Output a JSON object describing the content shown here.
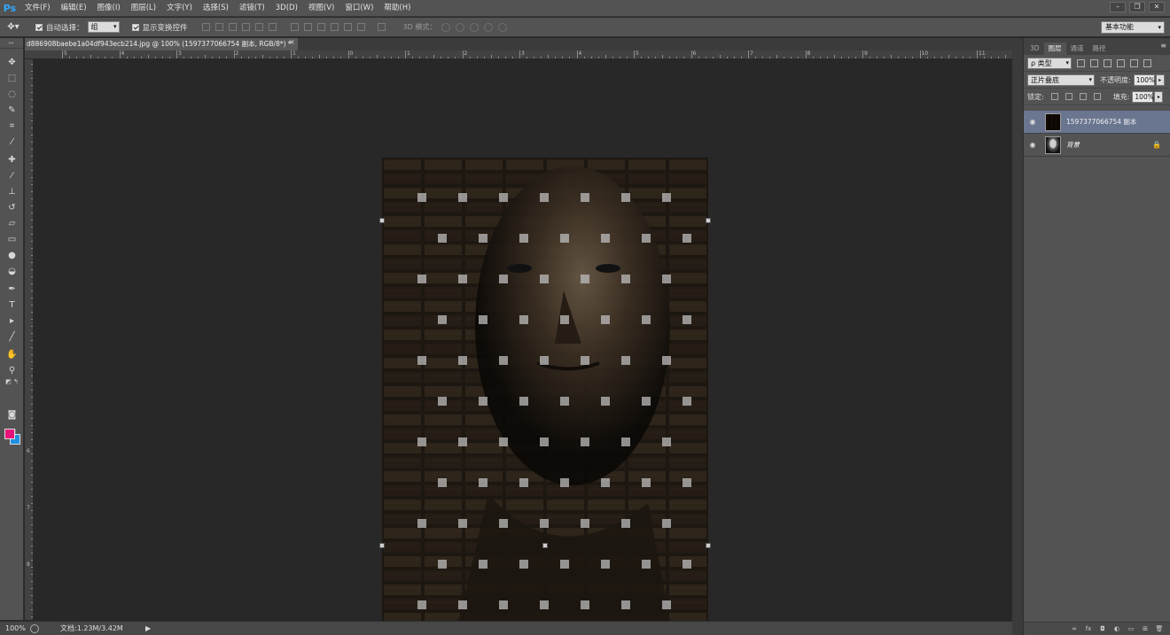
{
  "app": {
    "logo": "Ps",
    "menus": [
      "文件(F)",
      "编辑(E)",
      "图像(I)",
      "图层(L)",
      "文字(Y)",
      "选择(S)",
      "滤镜(T)",
      "3D(D)",
      "视图(V)",
      "窗口(W)",
      "帮助(H)"
    ],
    "window_controls": [
      "–",
      "❐",
      "✕"
    ]
  },
  "options": {
    "auto_select_label": "自动选择：",
    "auto_select_value": "组",
    "show_transform_label": "显示变换控件",
    "mode_3d_label": "3D 模式：",
    "workspace": "基本功能"
  },
  "document": {
    "tab_title": "d886908baebe1a04df943ecb214.jpg @ 100% (1597377066754 副本, RGB/8*) *",
    "tab_close": "×"
  },
  "rulers": {
    "top_labels": [
      "5",
      "4",
      "3",
      "2",
      "1",
      "0",
      "1",
      "2",
      "3",
      "4",
      "5",
      "6",
      "7",
      "8",
      "9",
      "10",
      "11"
    ],
    "left_labels": [
      "6",
      "7",
      "8"
    ]
  },
  "status": {
    "zoom": "100%",
    "doc_size": "文档:1.23M/3.42M",
    "arrow": "▶"
  },
  "panel": {
    "tabs": [
      "3D",
      "图层",
      "通道",
      "路径"
    ],
    "active_tab": "图层",
    "menu_icon": "≡",
    "filter_kind": "ρ 类型",
    "blend_mode": "正片叠底",
    "opacity_label": "不透明度:",
    "opacity_value": "100%",
    "lock_label": "锁定:",
    "fill_label": "填充:",
    "fill_value": "100%",
    "layers": [
      {
        "name": "1597377066754 副本",
        "selected": true
      },
      {
        "name": "背景",
        "selected": false,
        "locked": true
      }
    ],
    "footer_icons": [
      "link-icon",
      "fx-icon",
      "mask-icon",
      "adjustment-icon",
      "group-icon",
      "new-layer-icon",
      "trash-icon"
    ],
    "footer_glyphs": [
      "∞",
      "fx",
      "◘",
      "◐",
      "▭",
      "⊞",
      "🗑"
    ]
  },
  "colors": {
    "foreground": "#e6147a",
    "background": "#1e8fe0",
    "selected_layer": "#6a7590"
  }
}
